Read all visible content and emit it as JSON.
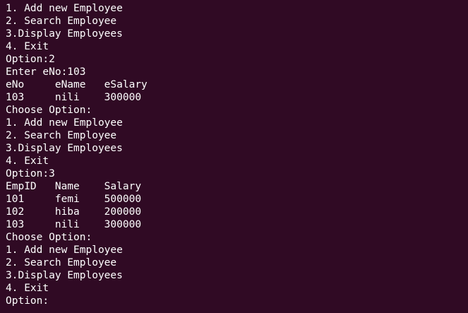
{
  "terminal": {
    "lines": [
      "1. Add new Employee",
      "2. Search Employee",
      "3.Display Employees",
      "4. Exit",
      "Option:2",
      "Enter eNo:103",
      "eNo     eName   eSalary",
      "103     nili    300000",
      "Choose Option:",
      "1. Add new Employee",
      "2. Search Employee",
      "3.Display Employees",
      "4. Exit",
      "Option:3",
      "EmpID   Name    Salary",
      "101     femi    500000",
      "102     hiba    200000",
      "103     nili    300000",
      "Choose Option:",
      "1. Add new Employee",
      "2. Search Employee",
      "3.Display Employees",
      "4. Exit",
      "Option:"
    ]
  }
}
